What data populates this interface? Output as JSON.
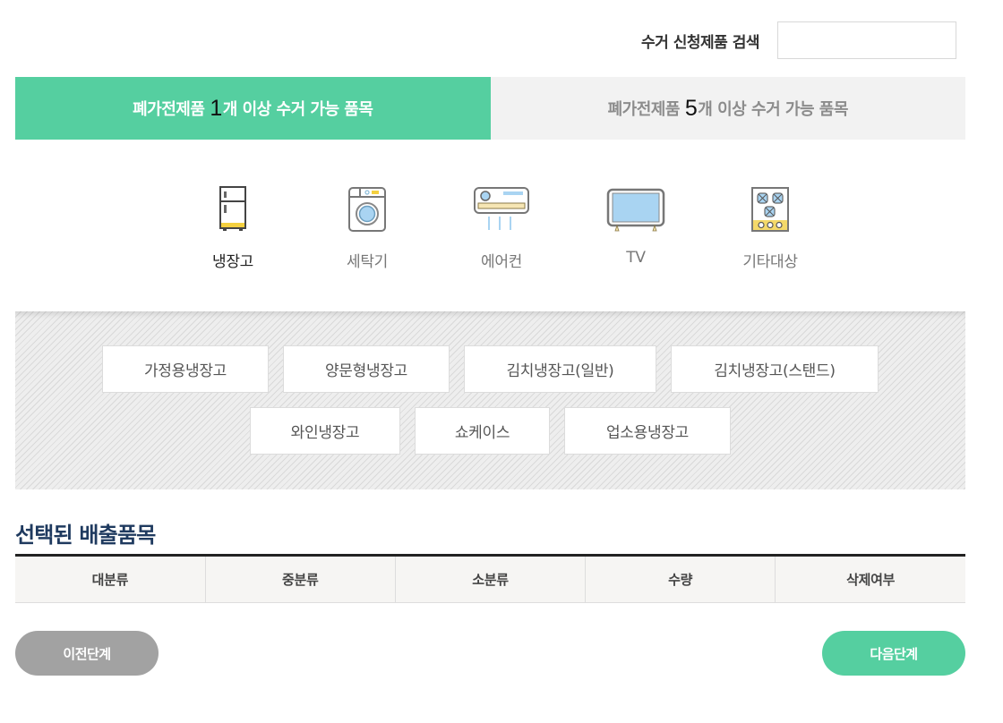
{
  "search": {
    "label": "수거 신청제품 검색",
    "value": "",
    "placeholder": ""
  },
  "tabs": [
    {
      "prefix": "폐가전제품",
      "count": "1",
      "suffix": "개 이상 수거 가능 품목",
      "active": true
    },
    {
      "prefix": "폐가전제품",
      "count": "5",
      "suffix": "개 이상 수거 가능 품목",
      "active": false
    }
  ],
  "categories": [
    {
      "label": "냉장고",
      "icon": "refrigerator-icon",
      "active": true
    },
    {
      "label": "세탁기",
      "icon": "washing-machine-icon",
      "active": false
    },
    {
      "label": "에어컨",
      "icon": "air-conditioner-icon",
      "active": false
    },
    {
      "label": "TV",
      "icon": "tv-icon",
      "active": false
    },
    {
      "label": "기타대상",
      "icon": "gas-stove-icon",
      "active": false
    }
  ],
  "subcategories": [
    "가정용냉장고",
    "양문형냉장고",
    "김치냉장고(일반)",
    "김치냉장고(스탠드)",
    "와인냉장고",
    "쇼케이스",
    "업소용냉장고"
  ],
  "selected": {
    "title": "선택된 배출품목",
    "columns": [
      "대분류",
      "중분류",
      "소분류",
      "수량",
      "삭제여부"
    ],
    "rows": []
  },
  "buttons": {
    "prev": "이전단계",
    "next": "다음단계"
  },
  "colors": {
    "accent": "#55cfa0",
    "inactive_tab_bg": "#f2f2f2",
    "prev_button": "#a2a2a2",
    "title": "#1f3a5f"
  }
}
